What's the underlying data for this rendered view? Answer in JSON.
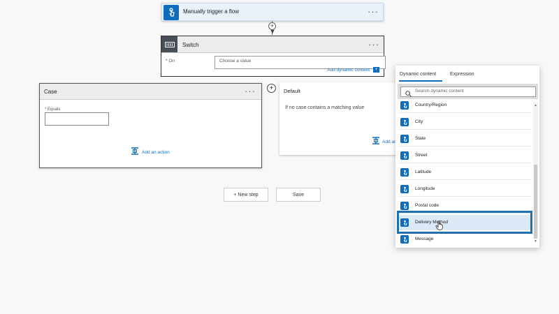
{
  "trigger": {
    "title": "Manually trigger a flow",
    "menu_label": "···",
    "icon": "hand-tap-icon"
  },
  "switch": {
    "title": "Switch",
    "menu_label": "···",
    "on_label": "* On",
    "on_placeholder": "Choose a value",
    "add_dynamic_label": "Add dynamic content",
    "icon": "switch-icon"
  },
  "case": {
    "title": "Case",
    "menu_label": "···",
    "equals_label": "* Equals",
    "add_action_label": "Add an action"
  },
  "default": {
    "title": "Default",
    "description": "If no case contains a matching value",
    "add_action_label": "Add an"
  },
  "buttons": {
    "new_step": "+ New step",
    "save": "Save"
  },
  "dynamic_panel": {
    "tabs": [
      "Dynamic content",
      "Expression"
    ],
    "active_tab": "Dynamic content",
    "search_placeholder": "Search dynamic content",
    "items": [
      "Country/Region",
      "City",
      "State",
      "Street",
      "Latitude",
      "Longitude",
      "Postal code",
      "Delivery Method",
      "Message"
    ],
    "selected_item": "Delivery Method"
  },
  "colors": {
    "accent": "#0f6cbd",
    "selection_frame": "#1f6fb3"
  }
}
